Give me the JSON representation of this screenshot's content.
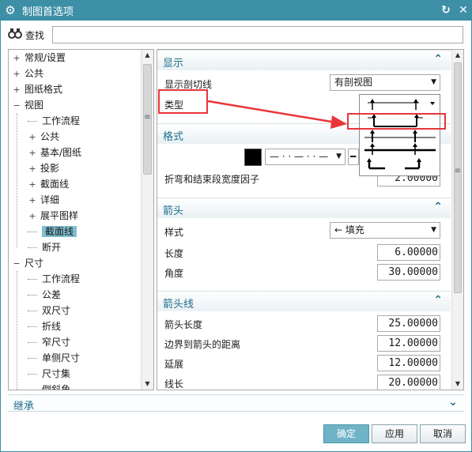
{
  "window": {
    "title": "制图首选项",
    "icon": "gear-icon",
    "reset_icon": "refresh-icon",
    "close_icon": "close-icon"
  },
  "search": {
    "icon": "binoculars-icon",
    "label": "查找",
    "value": "",
    "placeholder": ""
  },
  "tree": {
    "items": [
      {
        "label": "常规/设置",
        "expander": "+",
        "selected": false
      },
      {
        "label": "公共",
        "expander": "+",
        "selected": false
      },
      {
        "label": "图纸格式",
        "expander": "+",
        "selected": false
      },
      {
        "label": "视图",
        "expander": "−",
        "selected": false
      },
      {
        "label": "工作流程",
        "expander": "",
        "selected": false
      },
      {
        "label": "公共",
        "expander": "+",
        "selected": false
      },
      {
        "label": "基本/图纸",
        "expander": "+",
        "selected": false
      },
      {
        "label": "投影",
        "expander": "+",
        "selected": false
      },
      {
        "label": "截面线",
        "expander": "+",
        "selected": false
      },
      {
        "label": "详细",
        "expander": "+",
        "selected": false
      },
      {
        "label": "展平图样",
        "expander": "+",
        "selected": false
      },
      {
        "label": "截面线",
        "expander": "",
        "selected": true
      },
      {
        "label": "断开",
        "expander": "",
        "selected": false
      },
      {
        "label": "尺寸",
        "expander": "−",
        "selected": false
      },
      {
        "label": "工作流程",
        "expander": "",
        "selected": false
      },
      {
        "label": "公差",
        "expander": "",
        "selected": false
      },
      {
        "label": "双尺寸",
        "expander": "",
        "selected": false
      },
      {
        "label": "折线",
        "expander": "",
        "selected": false
      },
      {
        "label": "窄尺寸",
        "expander": "",
        "selected": false
      },
      {
        "label": "单侧尺寸",
        "expander": "",
        "selected": false
      },
      {
        "label": "尺寸集",
        "expander": "",
        "selected": false
      },
      {
        "label": "倒斜角",
        "expander": "",
        "selected": false
      }
    ]
  },
  "display_section": {
    "title": "显示",
    "show_cut_line_label": "显示剖切线",
    "show_cut_line_value": "有剖视图",
    "type_label": "类型"
  },
  "format_section": {
    "title": "格式",
    "line_style": "— · · — · · —",
    "bend_factor_label": "折弯和结束段宽度因子",
    "bend_factor_value": "2.00000"
  },
  "arrow_section": {
    "title": "箭头",
    "style_label": "样式",
    "style_value": "← 填充",
    "length_label": "长度",
    "length_value": "6.00000",
    "angle_label": "角度",
    "angle_value": "30.00000"
  },
  "arrow_line_section": {
    "title": "箭头线",
    "arrow_length_label": "箭头长度",
    "arrow_length_value": "25.00000",
    "border_distance_label": "边界到箭头的距离",
    "border_distance_value": "12.00000",
    "extension_label": "延展",
    "extension_value": "12.00000",
    "line_length_label": "线长",
    "line_length_value": "20.00000"
  },
  "inherit": {
    "label": "继承"
  },
  "buttons": {
    "ok": "确定",
    "apply": "应用",
    "cancel": "取消"
  },
  "colors": {
    "titlebar": "#3d8fa6",
    "section_title": "#1c6e88",
    "selection": "#7fbfd0",
    "annotation": "#e8353a"
  }
}
